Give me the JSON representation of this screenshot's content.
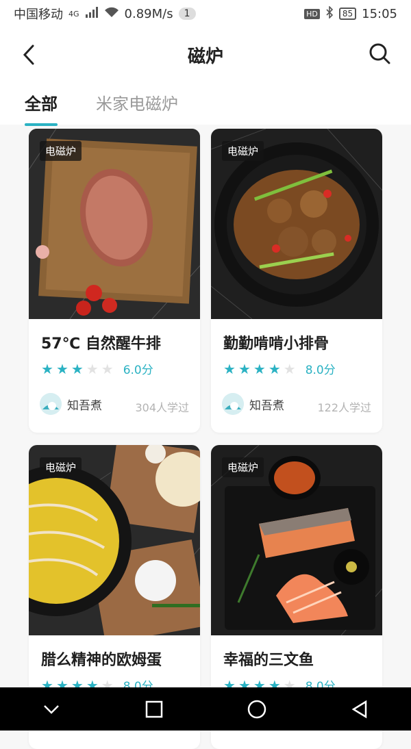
{
  "status_bar": {
    "carrier": "中国移动",
    "network": "4G",
    "speed": "0.89M/s",
    "notification_count": "1",
    "hd": "HD",
    "battery": "85",
    "time": "15:05"
  },
  "header": {
    "title": "磁炉"
  },
  "tabs": [
    {
      "label": "全部",
      "active": true
    },
    {
      "label": "米家电磁炉",
      "active": false
    }
  ],
  "recipes": [
    {
      "tag": "电磁炉",
      "name": "57℃ 自然醒牛排",
      "stars": 3,
      "score": "6.0分",
      "author": "知吾煮",
      "learned": "304人学过"
    },
    {
      "tag": "电磁炉",
      "name": "勤勤啃啃小排骨",
      "stars": 4,
      "score": "8.0分",
      "author": "知吾煮",
      "learned": "122人学过"
    },
    {
      "tag": "电磁炉",
      "name": "腊么精神的欧姆蛋",
      "stars": 4,
      "score": "8.0分",
      "author": "",
      "learned": ""
    },
    {
      "tag": "电磁炉",
      "name": "幸福的三文鱼",
      "stars": 4,
      "score": "8.0分",
      "author": "",
      "learned": ""
    }
  ],
  "colors": {
    "accent": "#2bb2c3"
  }
}
